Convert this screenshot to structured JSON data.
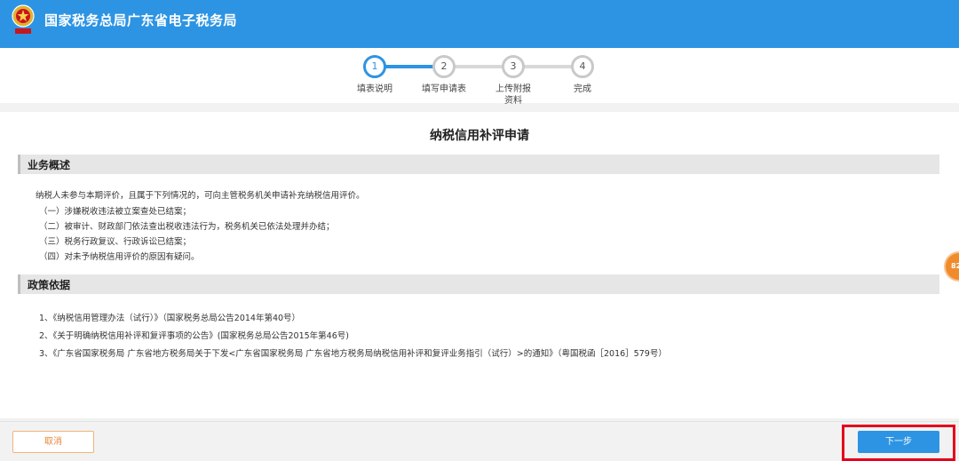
{
  "header": {
    "title": "国家税务总局广东省电子税务局",
    "logo_icon": "tax-emblem-icon",
    "bg_color": "#2d94e3"
  },
  "steps": [
    {
      "num": "1",
      "label": "填表说明",
      "state": "active"
    },
    {
      "num": "2",
      "label": "填写申请表",
      "state": "pending"
    },
    {
      "num": "3",
      "label": "上传附报资料",
      "state": "pending"
    },
    {
      "num": "4",
      "label": "完成",
      "state": "pending"
    }
  ],
  "main": {
    "title": "纳税信用补评申请",
    "overview": {
      "title": "业务概述",
      "lines": [
        "纳税人未参与本期评价，且属于下列情况的，可向主管税务机关申请补充纳税信用评价。",
        "（一）涉嫌税收违法被立案查处已结案；",
        "（二）被审计、财政部门依法查出税收违法行为，税务机关已依法处理并办结；",
        "（三）税务行政复议、行政诉讼已结案；",
        "（四）对未予纳税信用评价的原因有疑问。"
      ]
    },
    "policy": {
      "title": "政策依据",
      "lines": [
        "1、《纳税信用管理办法（试行）》（国家税务总局公告2014年第40号）",
        "2、《关于明确纳税信用补评和复评事项的公告》(国家税务总局公告2015年第46号)",
        "3、《广东省国家税务局 广东省地方税务局关于下发<广东省国家税务局 广东省地方税务局纳税信用补评和复评业务指引（试行）>的通知》（粤国税函［2016］579号）"
      ]
    }
  },
  "footer": {
    "cancel_label": "取消",
    "next_label": "下一步"
  },
  "side_badge": {
    "text": "82"
  },
  "colors": {
    "accent": "#2d94e3",
    "cancel_border": "#f0b57a",
    "cancel_text": "#e8883a",
    "highlight": "#e4001b"
  }
}
